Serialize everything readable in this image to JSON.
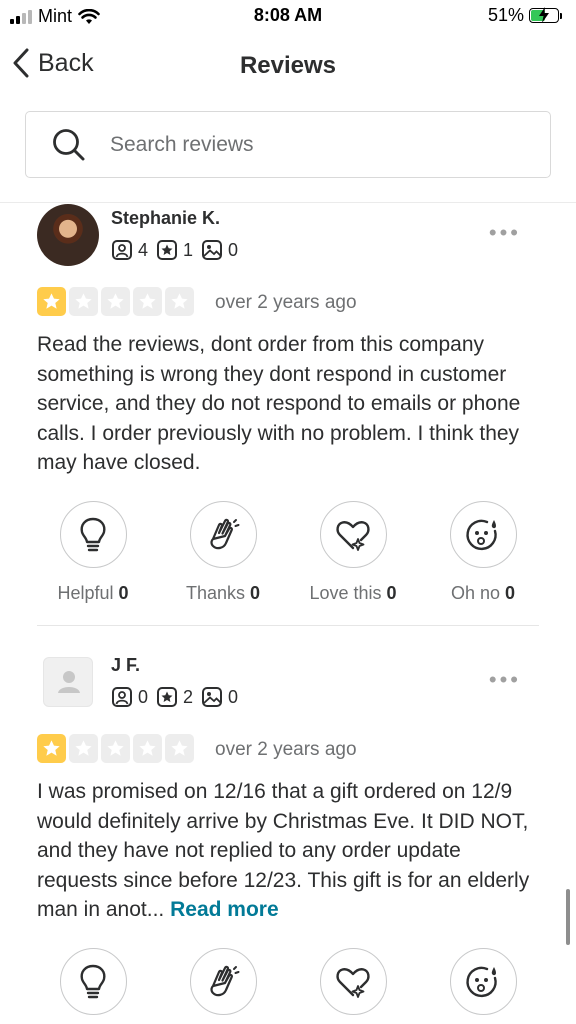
{
  "status_bar": {
    "carrier": "Mint",
    "time": "8:08 AM",
    "battery": "51%"
  },
  "nav": {
    "back_label": "Back",
    "title": "Reviews"
  },
  "search": {
    "placeholder": "Search reviews"
  },
  "reviews": [
    {
      "name": "Stephanie K.",
      "reviews_count": "4",
      "friends_count": "1",
      "photos_count": "0",
      "rating": 1,
      "date": "over 2 years ago",
      "text": "Read the reviews, dont order from this company something is wrong they dont respond in customer service, and they do not respond to emails or phone calls. I order previously with no problem. I think they may have closed.",
      "reactions": [
        {
          "label": "Helpful",
          "count": "0"
        },
        {
          "label": "Thanks",
          "count": "0"
        },
        {
          "label": "Love this",
          "count": "0"
        },
        {
          "label": "Oh no",
          "count": "0"
        }
      ]
    },
    {
      "name": "J F.",
      "reviews_count": "0",
      "friends_count": "2",
      "photos_count": "0",
      "rating": 1,
      "date": "over 2 years ago",
      "text": "I was promised on 12/16 that a gift ordered on 12/9 would definitely arrive by Christmas Eve. It DID NOT, and they have not replied to any order update requests since before 12/23. This gift is for an elderly man in anot...",
      "read_more": "Read more"
    }
  ],
  "colors": {
    "star_active": "#ffcc4b",
    "star_inactive": "#ededed",
    "link": "#027a97",
    "text": "#2d2e2f",
    "muted": "#6e7072"
  }
}
